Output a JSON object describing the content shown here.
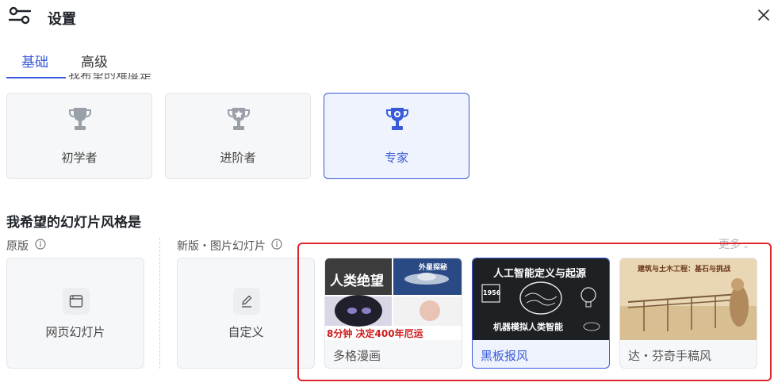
{
  "header": {
    "title": "设置",
    "icon": "sliders-icon",
    "close_icon": "close-icon"
  },
  "tabs": [
    {
      "label": "基础",
      "active": true
    },
    {
      "label": "高级",
      "active": false
    }
  ],
  "partial_text": "我希望的难度是",
  "levels": [
    {
      "label": "初学者",
      "icon": "trophy-icon",
      "active": false
    },
    {
      "label": "进阶者",
      "icon": "star-trophy-icon",
      "active": false
    },
    {
      "label": "专家",
      "icon": "medal-trophy-icon",
      "active": true
    }
  ],
  "style_section": {
    "title": "我希望的幻灯片风格是",
    "original_label": "原版",
    "new_label": "新版・图片幻灯片",
    "more_label": "更多",
    "original_options": [
      {
        "label": "网页幻灯片",
        "icon": "browser-window-icon"
      }
    ],
    "new_options": [
      {
        "label": "自定义",
        "icon": "edit-pen-icon"
      }
    ],
    "image_styles": [
      {
        "label": "多格漫画",
        "active": false,
        "thumb_text": {
          "title": "人类绝望",
          "tag": "外星探秘",
          "bottom": "8分钟 决定400年厄运"
        }
      },
      {
        "label": "黑板报风",
        "active": true,
        "thumb_text": {
          "title": "人工智能定义与起源",
          "year": "1956",
          "bottom": "机器模拟人类智能"
        }
      },
      {
        "label": "达・芬奇手稿风",
        "active": false,
        "thumb_text": {
          "title": "建筑与土木工程：基石与挑战"
        }
      }
    ]
  },
  "colors": {
    "accent": "#3a5bd9",
    "highlight_border": "#e0272b",
    "card_bg": "#f6f7f9"
  }
}
